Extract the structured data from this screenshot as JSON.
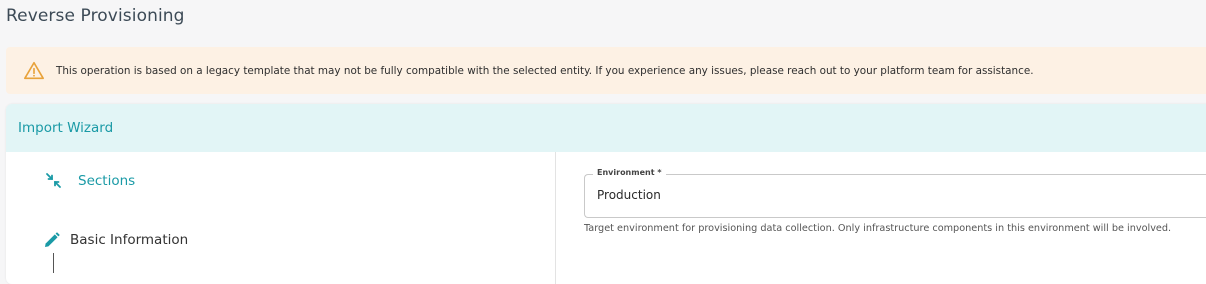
{
  "page": {
    "title": "Reverse Provisioning"
  },
  "alert": {
    "icon": "warning-icon",
    "message": "This operation is based on a legacy template that may not be fully compatible with the selected entity. If you experience any issues, please reach out to your platform team for assistance."
  },
  "wizard": {
    "title": "Import Wizard",
    "steps": [
      {
        "label": "Sections",
        "icon": "collapse-arrows-icon",
        "active": true
      },
      {
        "label": "Basic Information",
        "icon": "pencil-icon",
        "active": false
      }
    ]
  },
  "form": {
    "environment": {
      "label": "Environment *",
      "value": "Production",
      "helper": "Target environment for provisioning data collection. Only infrastructure components in this environment will be involved."
    }
  },
  "colors": {
    "accent": "#1a9aa6",
    "header_bg": "#e2f5f6",
    "alert_bg": "#fdf1e4",
    "warning": "#e8a23a"
  }
}
